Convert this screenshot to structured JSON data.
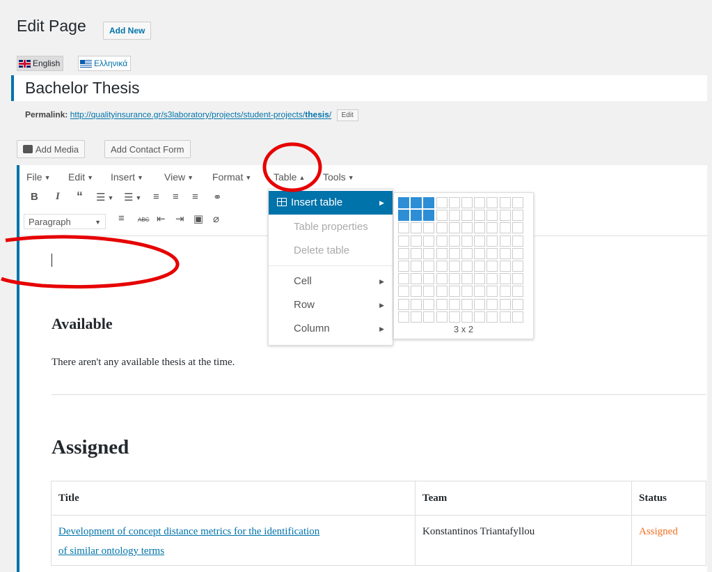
{
  "header": {
    "title": "Edit Page",
    "add_new": "Add New"
  },
  "languages": [
    {
      "label": "English",
      "flag": "uk-flag-icon",
      "active": true
    },
    {
      "label": "Ελληνικά",
      "flag": "greek-flag-icon",
      "active": false
    }
  ],
  "post_title": "Bachelor Thesis",
  "permalink": {
    "label": "Permalink:",
    "url_base": "http://qualityinsurance.gr/s3laboratory/projects/student-projects/",
    "slug": "thesis",
    "url_end": "/",
    "edit_label": "Edit"
  },
  "media_buttons": {
    "add_media": "Add Media",
    "add_contact_form": "Add Contact Form"
  },
  "menubar": {
    "items": [
      "File",
      "Edit",
      "Insert",
      "View",
      "Format",
      "Table",
      "Tools"
    ],
    "open_item": "Table"
  },
  "toolbar": {
    "format_select": "Paragraph",
    "row1": [
      "bold-icon",
      "italic-icon",
      "blockquote-icon",
      "bullet-list-icon",
      "numbered-list-icon",
      "align-left-icon",
      "align-center-icon",
      "align-right-icon",
      "link-icon"
    ],
    "row2": [
      "horizontal-line-icon",
      "strikethrough-icon",
      "outdent-icon",
      "indent-icon",
      "paste-text-icon",
      "clear-format-icon"
    ]
  },
  "table_menu": {
    "insert_table": "Insert table",
    "table_properties": "Table properties",
    "delete_table": "Delete table",
    "cell": "Cell",
    "row": "Row",
    "column": "Column"
  },
  "grid_picker": {
    "columns": 10,
    "rows": 10,
    "selected_cols": 3,
    "selected_rows": 2,
    "label": "3 x 2"
  },
  "content": {
    "heading_available": "Available",
    "available_text": "There aren't any available thesis at the time.",
    "heading_assigned": "Assigned",
    "table": {
      "headers": [
        "Title",
        "Team",
        "Status"
      ],
      "rows": [
        {
          "title_line1": "Development of concept distance metrics for the identification",
          "title_line2": "of similar ontology terms",
          "team": "Konstantinos Triantafyllou",
          "status": "Assigned"
        }
      ]
    }
  },
  "colors": {
    "accent": "#0073aa",
    "status_assigned": "#f46e1e",
    "annotation": "#e60000",
    "grid_selected": "#2d8ed6"
  }
}
